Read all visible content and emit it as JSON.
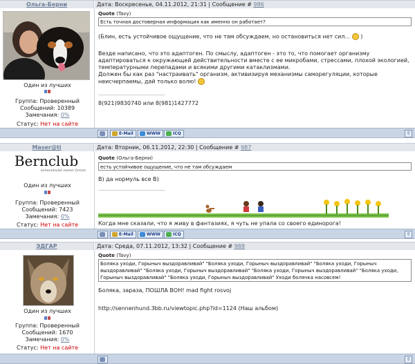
{
  "posts": [
    {
      "author": "Ольга-Берни",
      "date_label": "Дата: Воскресенье, 04.11.2012, 21:31 | Сообщение # ",
      "post_num": "986",
      "rank": "Один из лучших",
      "group": "Группа: Проверенный",
      "messages": "Сообщений: 10389",
      "remarks_label": "Замечания: ",
      "remarks_value": "0%",
      "status_label": "Статус: ",
      "status_value": "Нет на сайте",
      "quote_title": "Quote",
      "quote_author": "(Tavy)",
      "quote_text": "Есть точная достоверная информация как именно он работает?",
      "body_1": "(Блин, есть устойчивое ощущение, что не там обсуждаем, но остановиться нет сил...",
      "body_1_end": ")",
      "body_2": "Везде написано, что это адаптоген. По смыслу, адаптоген - это то, что помогает организму адаптироваться к окружающей действительности вместе с ее микробами, стрессами, плохой экологией, температурными перепадами и всякими другими катаклизмами.",
      "body_3": "Должен бы как раз \"настраивать\" организм, активизируя механизмы саморегуляции, которые неисчерпаемы, дай только волю!",
      "signature": "8(921)9830740 или 8(981)1427772"
    },
    {
      "author": "Maser@ti",
      "date_label": "Дата: Вторник, 06.11.2012, 22:30 | Сообщение # ",
      "post_num": "987",
      "logo_text": "Bernclub",
      "logo_sub": "sennenhund owner forum",
      "rank": "Один из лучших",
      "group": "Группа: Проверенный",
      "messages": "Сообщений: 7423",
      "remarks_label": "Замечания: ",
      "remarks_value": "0%",
      "status_label": "Статус: ",
      "status_value": "Нет на сайте",
      "quote_title": "Quote",
      "quote_author": "(Ольга-Берни)",
      "quote_text": "есть устойчивое ощущение, что не там обсуждаем",
      "body_1": "В) да нормуль все В)",
      "signature": "Когда мне сказали, что я живу в фантазиях, я чуть не упала со своего единорога!"
    },
    {
      "author": "ЭДГАР",
      "date_label": "Дата: Среда, 07.11.2012, 13:32 | Сообщение # ",
      "post_num": "988",
      "rank": "Один из лучших",
      "group": "Группа: Проверенный",
      "messages": "Сообщений: 1670",
      "remarks_label": "Замечания: ",
      "remarks_value": "0%",
      "status_label": "Статус: ",
      "status_value": "Нет на сайте",
      "quote_title": "Quote",
      "quote_author": "(Tavy)",
      "quote_text": "Боляка уходи, Горыныч выздоравливай\" \"Боляка уходи, Горыныч выздоравливай\" \"Боляка уходи, Горыныч выздоравливай\" \"Боляка уходи, Горыныч выздоравливай\" \"Боляка уходи, Горыныч выздоравливай\" \"Боляка уходи, Горыныч выздоравливай\" \"Боляка уходи, Горыныч выздоравливай\" Уходи болячка насовсем!",
      "body_1": "Боляка, зараза, ПОШЛА ВОН! mad fight rosvoj",
      "body_2": "http://sennenhund.3bb.ru/viewtopic.php?id=1124 (Наш альбом)"
    }
  ],
  "toolbar": {
    "email": "E-Mail",
    "www": "WWW",
    "icq": "ICQ",
    "top": "⇧"
  }
}
